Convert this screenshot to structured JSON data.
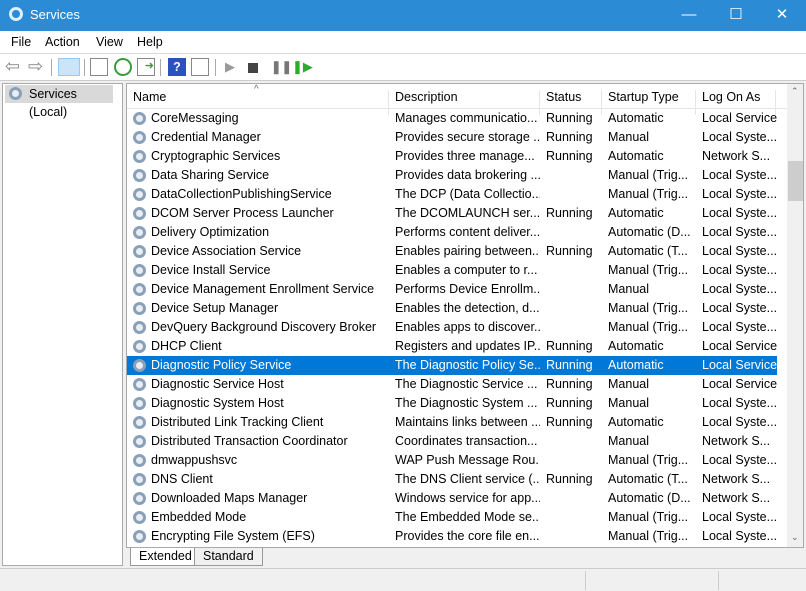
{
  "window": {
    "title": "Services",
    "minimize": "—",
    "maximize": "☐",
    "close": "✕"
  },
  "menu": [
    "File",
    "Action",
    "View",
    "Help"
  ],
  "toolbar": [
    "back-icon",
    "forward-icon",
    "show-hide-console-tree-icon",
    "properties-icon",
    "refresh-icon",
    "export-list-icon",
    "help-icon",
    "show-action-pane-icon",
    "start-service-icon",
    "stop-service-icon",
    "pause-service-icon",
    "restart-service-icon"
  ],
  "tree": {
    "root": "Services (Local)"
  },
  "columns": [
    "Name",
    "Description",
    "Status",
    "Startup Type",
    "Log On As"
  ],
  "rows": [
    [
      "CoreMessaging",
      "Manages communicatio...",
      "Running",
      "Automatic",
      "Local Service"
    ],
    [
      "Credential Manager",
      "Provides secure storage ...",
      "Running",
      "Manual",
      "Local Syste..."
    ],
    [
      "Cryptographic Services",
      "Provides three manage...",
      "Running",
      "Automatic",
      "Network S..."
    ],
    [
      "Data Sharing Service",
      "Provides data brokering ...",
      "",
      "Manual (Trig...",
      "Local Syste..."
    ],
    [
      "DataCollectionPublishingService",
      "The DCP (Data Collectio...",
      "",
      "Manual (Trig...",
      "Local Syste..."
    ],
    [
      "DCOM Server Process Launcher",
      "The DCOMLAUNCH ser...",
      "Running",
      "Automatic",
      "Local Syste..."
    ],
    [
      "Delivery Optimization",
      "Performs content deliver...",
      "",
      "Automatic (D...",
      "Local Syste..."
    ],
    [
      "Device Association Service",
      "Enables pairing between...",
      "Running",
      "Automatic (T...",
      "Local Syste..."
    ],
    [
      "Device Install Service",
      "Enables a computer to r...",
      "",
      "Manual (Trig...",
      "Local Syste..."
    ],
    [
      "Device Management Enrollment Service",
      "Performs Device Enrollm...",
      "",
      "Manual",
      "Local Syste..."
    ],
    [
      "Device Setup Manager",
      "Enables the detection, d...",
      "",
      "Manual (Trig...",
      "Local Syste..."
    ],
    [
      "DevQuery Background Discovery Broker",
      "Enables apps to discover...",
      "",
      "Manual (Trig...",
      "Local Syste..."
    ],
    [
      "DHCP Client",
      "Registers and updates IP...",
      "Running",
      "Automatic",
      "Local Service"
    ],
    [
      "Diagnostic Policy Service",
      "The Diagnostic Policy Se...",
      "Running",
      "Automatic",
      "Local Service"
    ],
    [
      "Diagnostic Service Host",
      "The Diagnostic Service ...",
      "Running",
      "Manual",
      "Local Service"
    ],
    [
      "Diagnostic System Host",
      "The Diagnostic System ...",
      "Running",
      "Manual",
      "Local Syste..."
    ],
    [
      "Distributed Link Tracking Client",
      "Maintains links between ...",
      "Running",
      "Automatic",
      "Local Syste..."
    ],
    [
      "Distributed Transaction Coordinator",
      "Coordinates transaction...",
      "",
      "Manual",
      "Network S..."
    ],
    [
      "dmwappushsvc",
      "WAP Push Message Rou...",
      "",
      "Manual (Trig...",
      "Local Syste..."
    ],
    [
      "DNS Client",
      "The DNS Client service (...",
      "Running",
      "Automatic (T...",
      "Network S..."
    ],
    [
      "Downloaded Maps Manager",
      "Windows service for app...",
      "",
      "Automatic (D...",
      "Network S..."
    ],
    [
      "Embedded Mode",
      "The Embedded Mode se...",
      "",
      "Manual (Trig...",
      "Local Syste..."
    ],
    [
      "Encrypting File System (EFS)",
      "Provides the core file en...",
      "",
      "Manual (Trig...",
      "Local Syste..."
    ]
  ],
  "selected_row": 13,
  "tabs": [
    "Extended",
    "Standard"
  ],
  "colors": {
    "titlebar": "#2b8bd4",
    "selection": "#0078d7"
  }
}
